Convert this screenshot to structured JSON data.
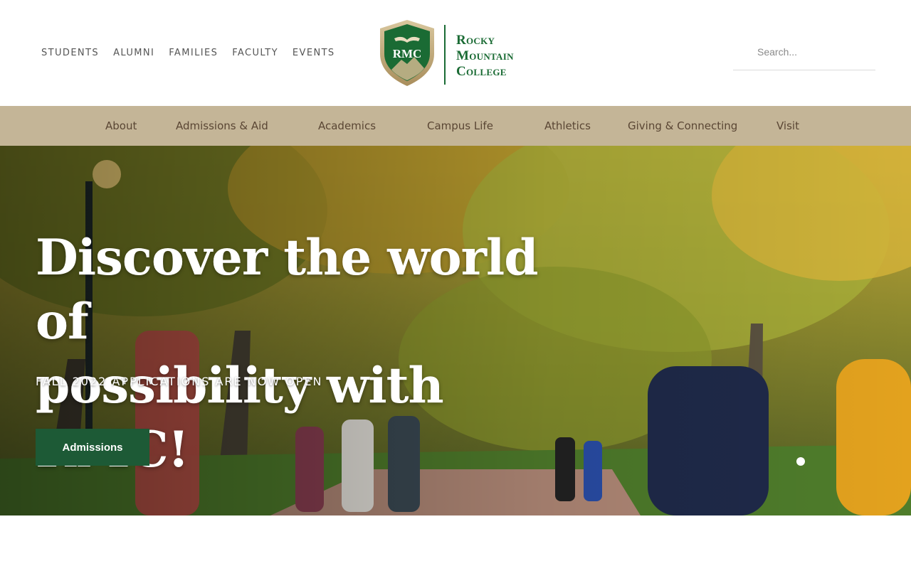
{
  "utility_nav": {
    "items": [
      "STUDENTS",
      "ALUMNI",
      "FAMILIES",
      "FACULTY",
      "EVENTS"
    ]
  },
  "logo": {
    "crest_text": "RMC",
    "name_lines": [
      "Rocky",
      "Mountain",
      "College"
    ]
  },
  "search": {
    "placeholder": "Search..."
  },
  "main_nav": {
    "items": [
      "About",
      "Admissions & Aid",
      "Academics",
      "Campus Life",
      "Athletics",
      "Giving & Connecting",
      "Visit"
    ]
  },
  "hero": {
    "title": "Discover the world of\npossibility with RMC!",
    "subtitle": "FALL 2022 APPLICATIONS ARE NOW OPEN",
    "cta_label": "Admissions"
  },
  "colors": {
    "brand_green": "#1a6b34",
    "nav_bg": "#c4b597",
    "nav_text": "#5a4634",
    "cta_bg": "#1d5a36",
    "crest_gold": "#c7b48a"
  }
}
